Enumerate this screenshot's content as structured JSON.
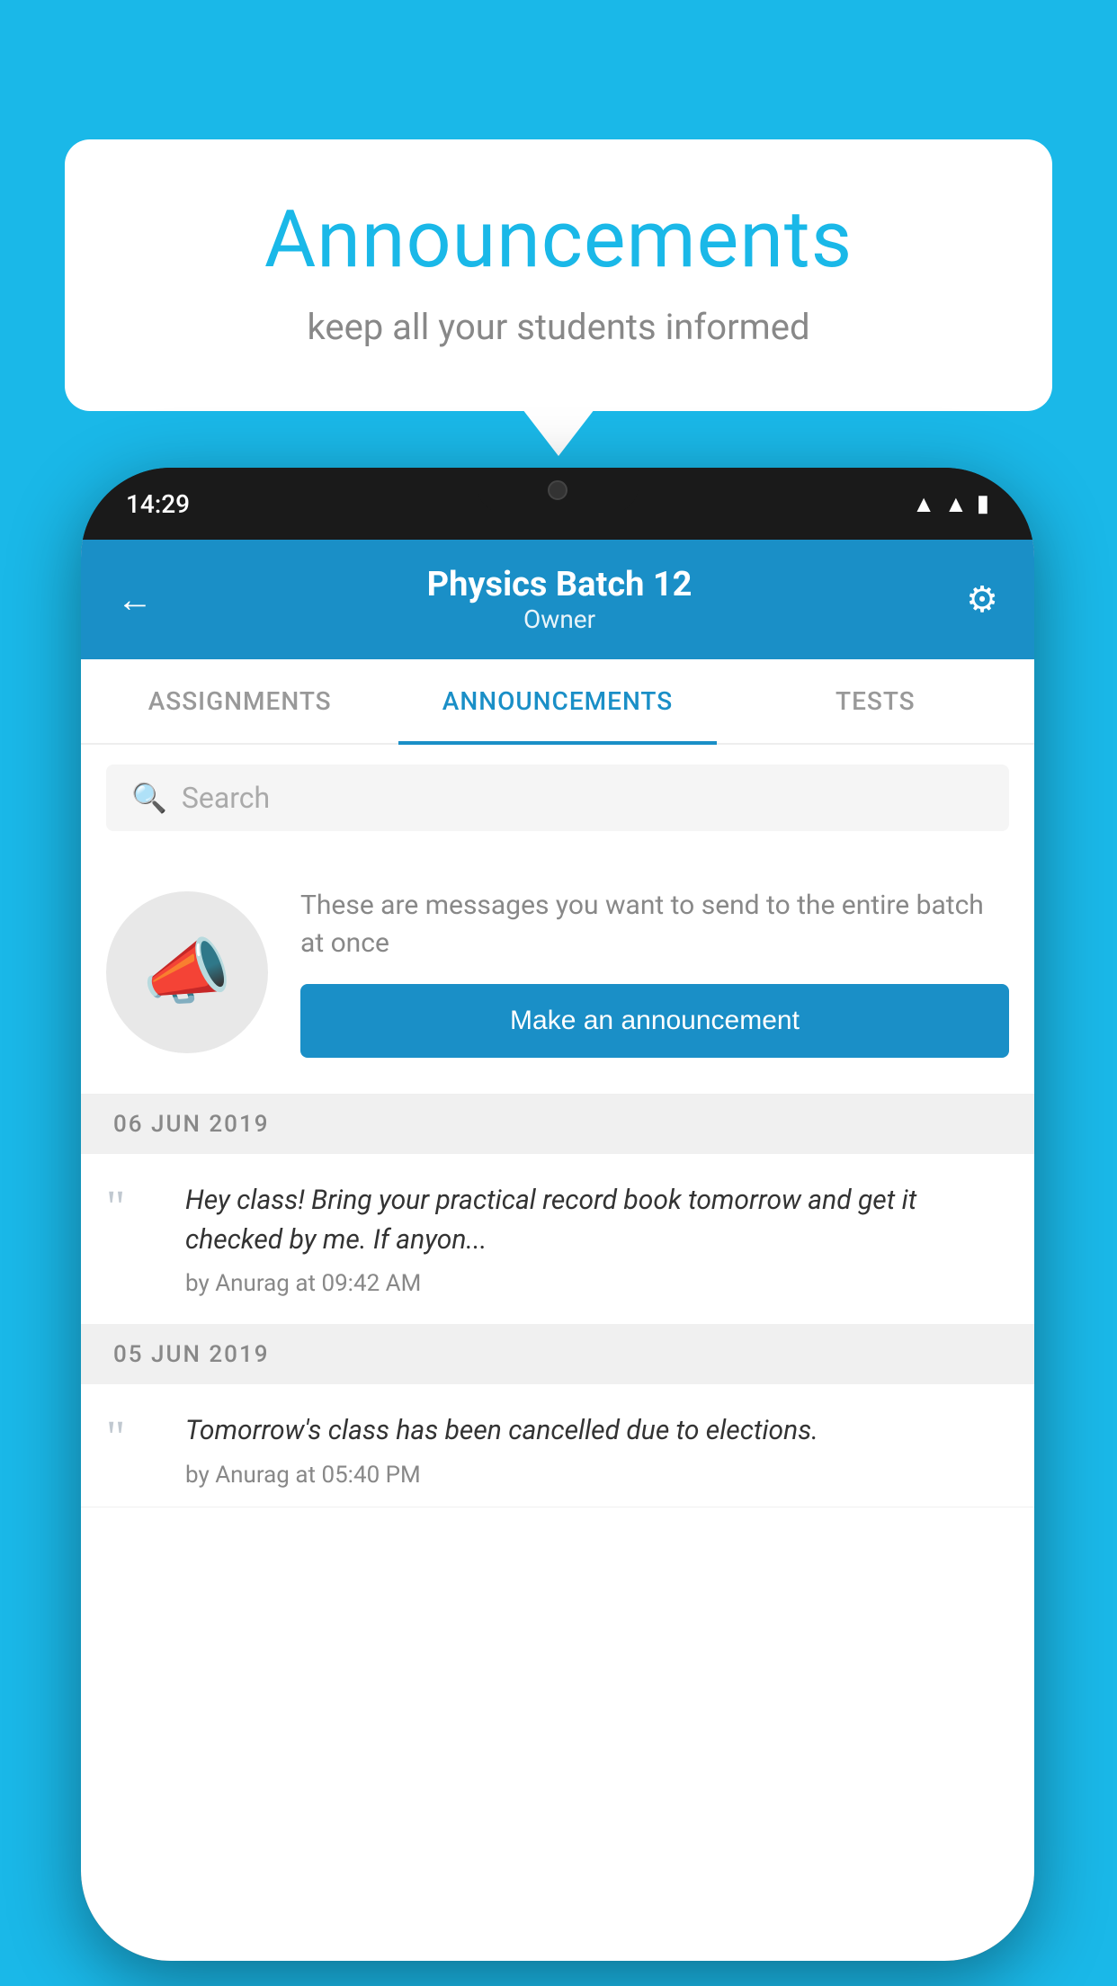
{
  "background_color": "#1ab8e8",
  "speech_bubble": {
    "title": "Announcements",
    "subtitle": "keep all your students informed"
  },
  "status_bar": {
    "time": "14:29",
    "icons": [
      "wifi",
      "signal",
      "battery"
    ]
  },
  "app_header": {
    "title": "Physics Batch 12",
    "subtitle": "Owner",
    "back_label": "←",
    "settings_label": "⚙"
  },
  "tabs": [
    {
      "label": "ASSIGNMENTS",
      "active": false
    },
    {
      "label": "ANNOUNCEMENTS",
      "active": true
    },
    {
      "label": "TESTS",
      "active": false
    },
    {
      "label": "...",
      "active": false
    }
  ],
  "search": {
    "placeholder": "Search"
  },
  "announcement_prompt": {
    "description_text": "These are messages you want to send to the entire batch at once",
    "button_label": "Make an announcement"
  },
  "announcements": [
    {
      "date": "06  JUN  2019",
      "text": "Hey class! Bring your practical record book tomorrow and get it checked by me. If anyon...",
      "meta": "by Anurag at 09:42 AM"
    },
    {
      "date": "05  JUN  2019",
      "text": "Tomorrow's class has been cancelled due to elections.",
      "meta": "by Anurag at 05:40 PM"
    }
  ]
}
